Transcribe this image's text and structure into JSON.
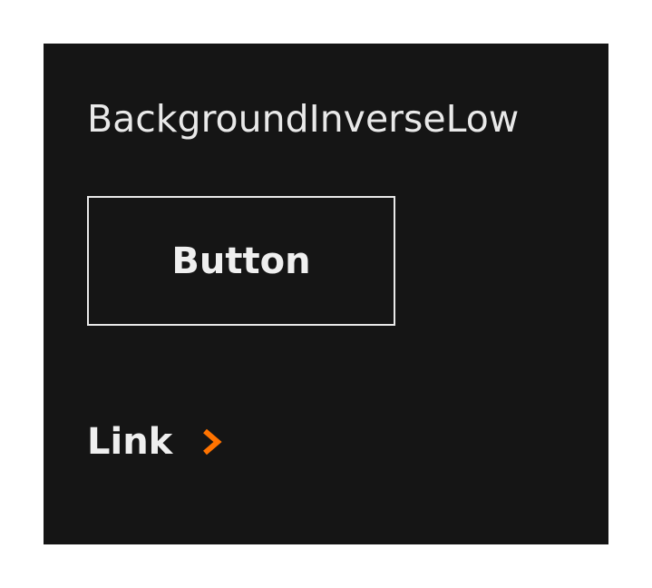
{
  "panel": {
    "background_color": "#151515",
    "title": "BackgroundInverseLow"
  },
  "button": {
    "label": "Button",
    "border_color": "#e9e9e9"
  },
  "link": {
    "label": "Link",
    "icon": "chevron-right-icon",
    "icon_color": "#ff7300"
  }
}
